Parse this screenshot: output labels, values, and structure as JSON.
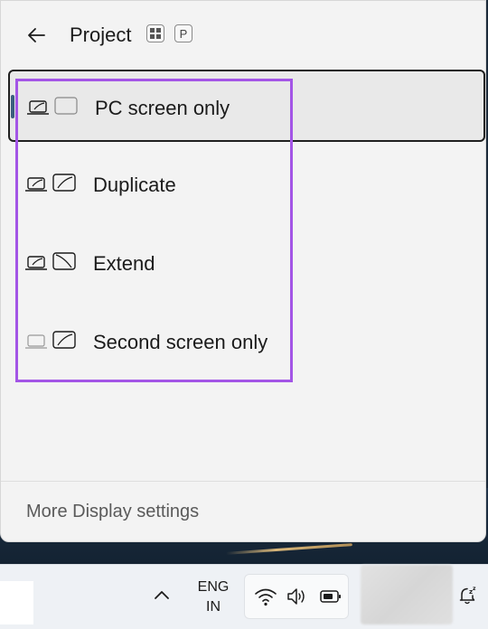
{
  "header": {
    "title": "Project",
    "shortcut_key": "P"
  },
  "options": [
    {
      "label": "PC screen only",
      "selected": true
    },
    {
      "label": "Duplicate",
      "selected": false
    },
    {
      "label": "Extend",
      "selected": false
    },
    {
      "label": "Second screen only",
      "selected": false
    }
  ],
  "footer": {
    "more_settings": "More Display settings"
  },
  "taskbar": {
    "lang_line1": "ENG",
    "lang_line2": "IN"
  },
  "colors": {
    "accent": "#3b5f7e",
    "highlight": "#a355e6",
    "panel_bg": "#f3f3f3"
  }
}
